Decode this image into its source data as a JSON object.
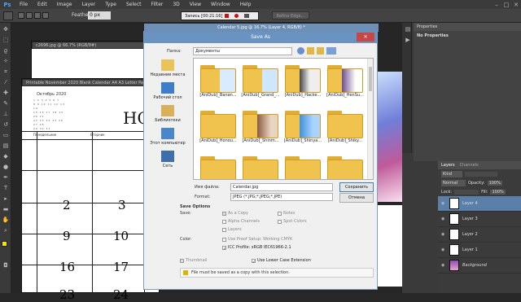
{
  "menubar": {
    "logo": "Ps",
    "items": [
      "File",
      "Edit",
      "Image",
      "Layer",
      "Type",
      "Select",
      "Filter",
      "3D",
      "View",
      "Window",
      "Help"
    ]
  },
  "options_bar": {
    "feather_label": "Feather:",
    "feather_value": "0 px",
    "recording": "Запись [00:21:16]",
    "refine_edge": "Refine Edge..."
  },
  "documents": {
    "tab1": "c2696.jpg @ 66.7% (RGB/8#)",
    "tab2": "Printable November 2020 Blank Calendar A4 A3 Letter Pa..."
  },
  "calendar": {
    "header_letters": "НО",
    "mini_month": "Октябрь 2020",
    "weekdays": [
      "Понедельник",
      "Вторник"
    ],
    "numbers": [
      "2",
      "3",
      "9",
      "10",
      "16",
      "17",
      "23",
      "24"
    ]
  },
  "right_panel": {
    "properties_head": "Properties",
    "no_properties": "No Properties",
    "tabs": [
      "Layers",
      "Channels"
    ],
    "kind": "Kind",
    "mode": "Normal",
    "opacity_label": "Opacity:",
    "opacity": "100%",
    "lock_label": "Lock:",
    "fill_label": "Fill:",
    "fill": "100%",
    "layers": [
      "Layer 4",
      "Layer 3",
      "Layer 2",
      "Layer 1",
      "Background"
    ]
  },
  "dialog": {
    "window_title": "Calendar 5.jpg @ 16.7% (Layer 4, RGB/8) *",
    "title": "Save As",
    "folder_label": "Папка:",
    "folder_value": "Документы",
    "places": [
      "Недавние места",
      "Рабочий стол",
      "Библиотеки",
      "Этот компьютер",
      "Сеть"
    ],
    "files": [
      "[AniDub]_Banan...",
      "[AniDub]_Grand_...",
      "[AniDub]_Hacke...",
      "[AniDub]_HenSu...",
      "[AniDub]_Honou...",
      "[AniDub]_Shinm...",
      "[AniDub]_Shinya...",
      "[AniDub]_Shiky..."
    ],
    "filename_label": "Имя файла:",
    "filename": "Calendar.jpg",
    "format_label": "Format:",
    "format": "JPEG (*.JPG;*.JPEG;*.JPE)",
    "save_btn": "Сохранить",
    "cancel_btn": "Отмена",
    "save_options": "Save Options",
    "save_label": "Save:",
    "as_copy": "As a Copy",
    "notes": "Notes",
    "alpha": "Alpha Channels",
    "spot": "Spot Colors",
    "layers_opt": "Layers",
    "color_label": "Color:",
    "proof": "Use Proof Setup: Working CMYK",
    "icc": "ICC Profile: sRGB IEC61966-2.1",
    "thumbnail": "Thumbnail",
    "lowercase": "Use Lower Case Extension",
    "warning": "File must be saved as a copy with this selection."
  }
}
